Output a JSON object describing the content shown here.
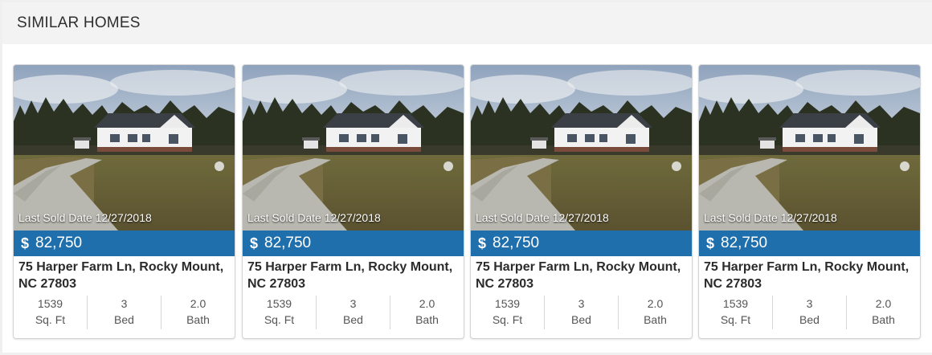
{
  "section": {
    "title": "SIMILAR HOMES"
  },
  "colors": {
    "price_bar": "#1f6fad",
    "header_bg": "#f3f3f3"
  },
  "listings": [
    {
      "sold_label": "Last Sold Date 12/27/2018",
      "currency": "$",
      "price": "82,750",
      "address_line1": "75 Harper Farm Ln, Rocky Mount,",
      "address_line2": "NC 27803",
      "stats": [
        {
          "value": "1539",
          "label": "Sq. Ft"
        },
        {
          "value": "3",
          "label": "Bed"
        },
        {
          "value": "2.0",
          "label": "Bath"
        }
      ]
    },
    {
      "sold_label": "Last Sold Date 12/27/2018",
      "currency": "$",
      "price": "82,750",
      "address_line1": "75 Harper Farm Ln, Rocky Mount,",
      "address_line2": "NC 27803",
      "stats": [
        {
          "value": "1539",
          "label": "Sq. Ft"
        },
        {
          "value": "3",
          "label": "Bed"
        },
        {
          "value": "2.0",
          "label": "Bath"
        }
      ]
    },
    {
      "sold_label": "Last Sold Date 12/27/2018",
      "currency": "$",
      "price": "82,750",
      "address_line1": "75 Harper Farm Ln, Rocky Mount,",
      "address_line2": "NC 27803",
      "stats": [
        {
          "value": "1539",
          "label": "Sq. Ft"
        },
        {
          "value": "3",
          "label": "Bed"
        },
        {
          "value": "2.0",
          "label": "Bath"
        }
      ]
    },
    {
      "sold_label": "Last Sold Date 12/27/2018",
      "currency": "$",
      "price": "82,750",
      "address_line1": "75 Harper Farm Ln, Rocky Mount,",
      "address_line2": "NC 27803",
      "stats": [
        {
          "value": "1539",
          "label": "Sq. Ft"
        },
        {
          "value": "3",
          "label": "Bed"
        },
        {
          "value": "2.0",
          "label": "Bath"
        }
      ]
    }
  ]
}
